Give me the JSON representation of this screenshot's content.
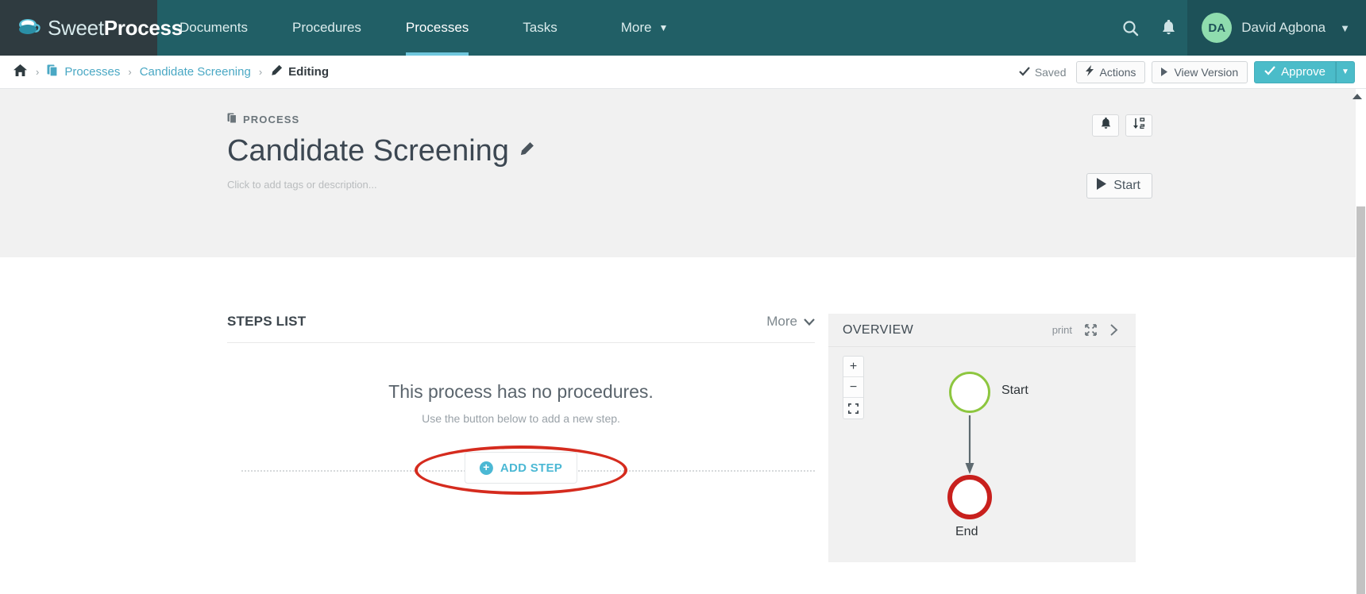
{
  "nav": {
    "brand": {
      "light": "Sweet",
      "bold": "Process",
      "logo_icon": "coffee-cup-icon"
    },
    "items": [
      {
        "label": "Documents",
        "active": false
      },
      {
        "label": "Procedures",
        "active": false
      },
      {
        "label": "Processes",
        "active": true
      },
      {
        "label": "Tasks",
        "active": false
      },
      {
        "label": "More",
        "active": false,
        "caret": "▼"
      }
    ],
    "search_icon": "search-icon",
    "bell_icon": "bell-icon",
    "user": {
      "initials": "DA",
      "name": "David Agbona",
      "caret": "▼"
    }
  },
  "breadcrumb": {
    "home_icon": "home-icon",
    "separator": "›",
    "processes_label": "Processes",
    "processes_icon": "copy-icon",
    "candidate_label": "Candidate Screening",
    "editing_label": "Editing",
    "editing_icon": "pencil-icon"
  },
  "actionbar": {
    "saved_label": "Saved",
    "saved_icon": "check-icon",
    "actions_label": "Actions",
    "actions_icon": "bolt-icon",
    "view_version_label": "View Version",
    "view_version_icon": "play-icon",
    "approve_label": "Approve",
    "approve_icon": "check-icon",
    "approve_caret": "▼",
    "approve_color": "#4bbcc9"
  },
  "header": {
    "eyebrow": "PROCESS",
    "eyebrow_icon": "copy-icon",
    "title": "Candidate Screening",
    "title_edit_icon": "pencil-icon",
    "tagline": "Click to add tags or description...",
    "notify_icon": "bell-icon",
    "sort_icon": "sort-numeric-icon",
    "start_label": "Start",
    "start_icon": "play-icon"
  },
  "steps": {
    "title": "STEPS LIST",
    "more_label": "More",
    "more_caret": "▼",
    "empty_title": "This process has no procedures.",
    "empty_subtitle": "Use the button below to add a new step.",
    "add_step_label": "ADD STEP",
    "add_step_icon": "plus-circle-icon",
    "add_step_color": "#4bb8d4",
    "annotation_color": "#d52b1e"
  },
  "overview": {
    "title": "OVERVIEW",
    "print_label": "print",
    "expand_icon": "expand-arrows-icon",
    "collapse_icon": "chevron-right-icon",
    "zoom_in_label": "+",
    "zoom_out_label": "−",
    "fit_icon": "fit-screen-icon",
    "start_node_label": "Start",
    "start_node_color": "#8dc63f",
    "end_node_label": "End",
    "end_node_color": "#c8201d"
  }
}
